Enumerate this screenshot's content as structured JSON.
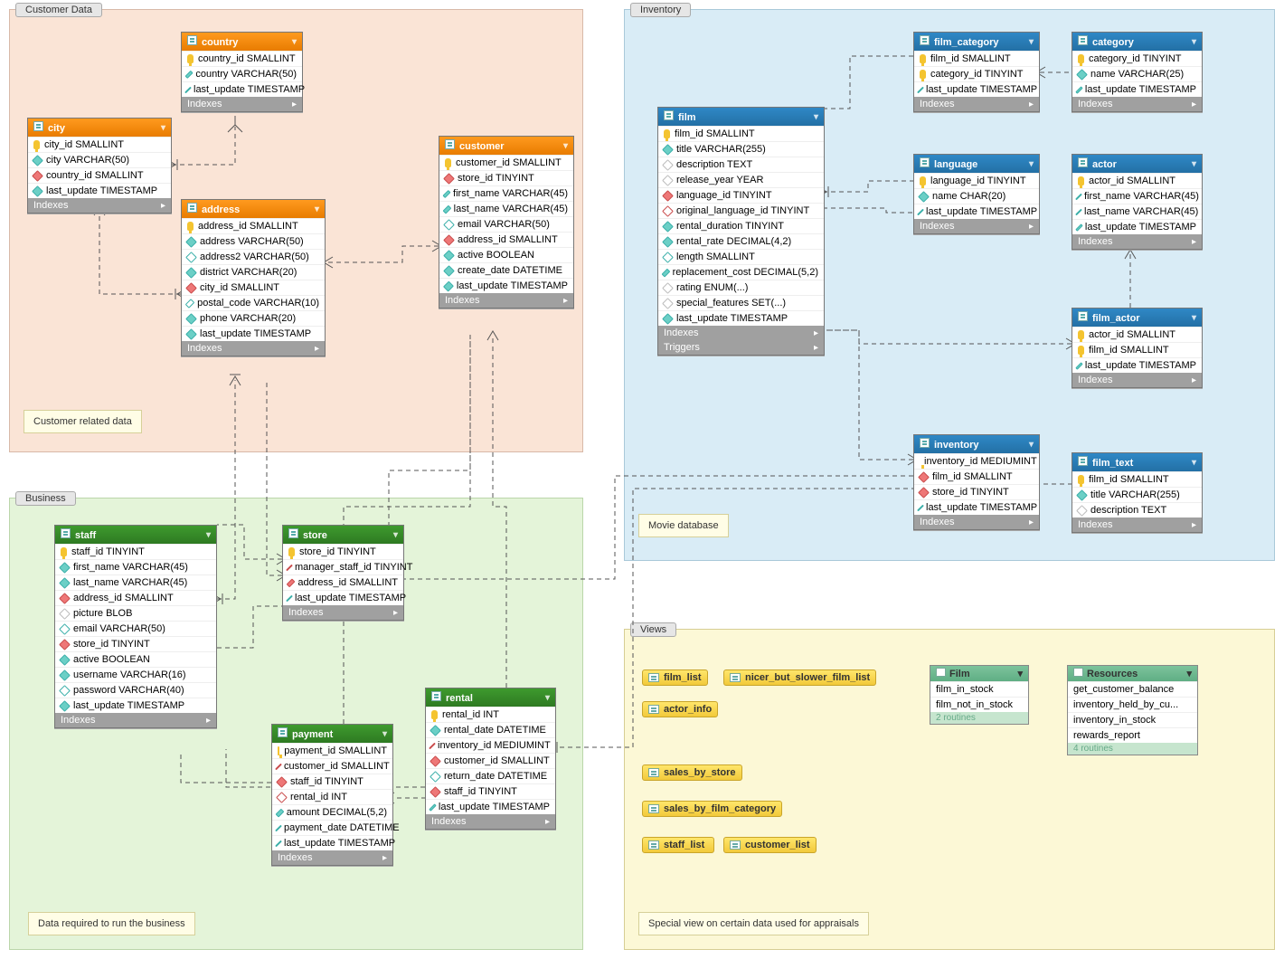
{
  "regions": {
    "customer": {
      "label": "Customer Data",
      "note": "Customer related data"
    },
    "business": {
      "label": "Business",
      "note": "Data required to run the business"
    },
    "inventory": {
      "label": "Inventory",
      "note": "Movie database"
    },
    "views": {
      "label": "Views",
      "note": "Special view on certain data used for appraisals"
    }
  },
  "section_labels": {
    "indexes": "Indexes",
    "triggers": "Triggers"
  },
  "entities": {
    "country": {
      "title": "country",
      "cols": [
        {
          "i": "pk",
          "t": "country_id SMALLINT"
        },
        {
          "i": "c-cyan f",
          "t": "country VARCHAR(50)"
        },
        {
          "i": "c-cyan f",
          "t": "last_update TIMESTAMP"
        }
      ],
      "sects": [
        "indexes"
      ]
    },
    "city": {
      "title": "city",
      "cols": [
        {
          "i": "pk",
          "t": "city_id SMALLINT"
        },
        {
          "i": "c-cyan f",
          "t": "city VARCHAR(50)"
        },
        {
          "i": "c-red f",
          "t": "country_id SMALLINT"
        },
        {
          "i": "c-cyan f",
          "t": "last_update TIMESTAMP"
        }
      ],
      "sects": [
        "indexes"
      ]
    },
    "address": {
      "title": "address",
      "cols": [
        {
          "i": "pk",
          "t": "address_id SMALLINT"
        },
        {
          "i": "c-cyan f",
          "t": "address VARCHAR(50)"
        },
        {
          "i": "c-cyan",
          "t": "address2 VARCHAR(50)"
        },
        {
          "i": "c-cyan f",
          "t": "district VARCHAR(20)"
        },
        {
          "i": "c-red f",
          "t": "city_id SMALLINT"
        },
        {
          "i": "c-cyan",
          "t": "postal_code VARCHAR(10)"
        },
        {
          "i": "c-cyan f",
          "t": "phone VARCHAR(20)"
        },
        {
          "i": "c-cyan f",
          "t": "last_update TIMESTAMP"
        }
      ],
      "sects": [
        "indexes"
      ]
    },
    "customer": {
      "title": "customer",
      "cols": [
        {
          "i": "pk",
          "t": "customer_id SMALLINT"
        },
        {
          "i": "c-red f",
          "t": "store_id TINYINT"
        },
        {
          "i": "c-cyan f",
          "t": "first_name VARCHAR(45)"
        },
        {
          "i": "c-cyan f",
          "t": "last_name VARCHAR(45)"
        },
        {
          "i": "c-cyan",
          "t": "email VARCHAR(50)"
        },
        {
          "i": "c-red f",
          "t": "address_id SMALLINT"
        },
        {
          "i": "c-cyan f",
          "t": "active BOOLEAN"
        },
        {
          "i": "c-cyan f",
          "t": "create_date DATETIME"
        },
        {
          "i": "c-cyan f",
          "t": "last_update TIMESTAMP"
        }
      ],
      "sects": [
        "indexes"
      ]
    },
    "staff": {
      "title": "staff",
      "cols": [
        {
          "i": "pk",
          "t": "staff_id TINYINT"
        },
        {
          "i": "c-cyan f",
          "t": "first_name VARCHAR(45)"
        },
        {
          "i": "c-cyan f",
          "t": "last_name VARCHAR(45)"
        },
        {
          "i": "c-red f",
          "t": "address_id SMALLINT"
        },
        {
          "i": "c-none",
          "t": "picture BLOB"
        },
        {
          "i": "c-cyan",
          "t": "email VARCHAR(50)"
        },
        {
          "i": "c-red f",
          "t": "store_id TINYINT"
        },
        {
          "i": "c-cyan f",
          "t": "active BOOLEAN"
        },
        {
          "i": "c-cyan f",
          "t": "username VARCHAR(16)"
        },
        {
          "i": "c-cyan",
          "t": "password VARCHAR(40)"
        },
        {
          "i": "c-cyan f",
          "t": "last_update TIMESTAMP"
        }
      ],
      "sects": [
        "indexes"
      ]
    },
    "store": {
      "title": "store",
      "cols": [
        {
          "i": "pk",
          "t": "store_id TINYINT"
        },
        {
          "i": "c-red f",
          "t": "manager_staff_id TINYINT"
        },
        {
          "i": "c-red f",
          "t": "address_id SMALLINT"
        },
        {
          "i": "c-cyan f",
          "t": "last_update TIMESTAMP"
        }
      ],
      "sects": [
        "indexes"
      ]
    },
    "payment": {
      "title": "payment",
      "cols": [
        {
          "i": "pk",
          "t": "payment_id SMALLINT"
        },
        {
          "i": "c-red f",
          "t": "customer_id SMALLINT"
        },
        {
          "i": "c-red f",
          "t": "staff_id TINYINT"
        },
        {
          "i": "c-red",
          "t": "rental_id INT"
        },
        {
          "i": "c-cyan f",
          "t": "amount DECIMAL(5,2)"
        },
        {
          "i": "c-cyan f",
          "t": "payment_date DATETIME"
        },
        {
          "i": "c-cyan f",
          "t": "last_update TIMESTAMP"
        }
      ],
      "sects": [
        "indexes"
      ]
    },
    "rental": {
      "title": "rental",
      "cols": [
        {
          "i": "pk",
          "t": "rental_id INT"
        },
        {
          "i": "c-cyan f",
          "t": "rental_date DATETIME"
        },
        {
          "i": "c-red f",
          "t": "inventory_id MEDIUMINT"
        },
        {
          "i": "c-red f",
          "t": "customer_id SMALLINT"
        },
        {
          "i": "c-cyan",
          "t": "return_date DATETIME"
        },
        {
          "i": "c-red f",
          "t": "staff_id TINYINT"
        },
        {
          "i": "c-cyan f",
          "t": "last_update TIMESTAMP"
        }
      ],
      "sects": [
        "indexes"
      ]
    },
    "film": {
      "title": "film",
      "cols": [
        {
          "i": "pk",
          "t": "film_id SMALLINT"
        },
        {
          "i": "c-cyan f",
          "t": "title VARCHAR(255)"
        },
        {
          "i": "c-none",
          "t": "description TEXT"
        },
        {
          "i": "c-none",
          "t": "release_year YEAR"
        },
        {
          "i": "c-red f",
          "t": "language_id TINYINT"
        },
        {
          "i": "c-red",
          "t": "original_language_id TINYINT"
        },
        {
          "i": "c-cyan f",
          "t": "rental_duration TINYINT"
        },
        {
          "i": "c-cyan f",
          "t": "rental_rate DECIMAL(4,2)"
        },
        {
          "i": "c-cyan",
          "t": "length SMALLINT"
        },
        {
          "i": "c-cyan f",
          "t": "replacement_cost DECIMAL(5,2)"
        },
        {
          "i": "c-none",
          "t": "rating ENUM(...)"
        },
        {
          "i": "c-none",
          "t": "special_features SET(...)"
        },
        {
          "i": "c-cyan f",
          "t": "last_update TIMESTAMP"
        }
      ],
      "sects": [
        "indexes",
        "triggers"
      ]
    },
    "film_category": {
      "title": "film_category",
      "cols": [
        {
          "i": "pk",
          "t": "film_id SMALLINT"
        },
        {
          "i": "pk",
          "t": "category_id TINYINT"
        },
        {
          "i": "c-cyan f",
          "t": "last_update TIMESTAMP"
        }
      ],
      "sects": [
        "indexes"
      ]
    },
    "category": {
      "title": "category",
      "cols": [
        {
          "i": "pk",
          "t": "category_id TINYINT"
        },
        {
          "i": "c-cyan f",
          "t": "name VARCHAR(25)"
        },
        {
          "i": "c-cyan f",
          "t": "last_update TIMESTAMP"
        }
      ],
      "sects": [
        "indexes"
      ]
    },
    "language": {
      "title": "language",
      "cols": [
        {
          "i": "pk",
          "t": "language_id TINYINT"
        },
        {
          "i": "c-cyan f",
          "t": "name CHAR(20)"
        },
        {
          "i": "c-cyan f",
          "t": "last_update TIMESTAMP"
        }
      ],
      "sects": [
        "indexes"
      ]
    },
    "actor": {
      "title": "actor",
      "cols": [
        {
          "i": "pk",
          "t": "actor_id SMALLINT"
        },
        {
          "i": "c-cyan f",
          "t": "first_name VARCHAR(45)"
        },
        {
          "i": "c-cyan f",
          "t": "last_name VARCHAR(45)"
        },
        {
          "i": "c-cyan f",
          "t": "last_update TIMESTAMP"
        }
      ],
      "sects": [
        "indexes"
      ]
    },
    "film_actor": {
      "title": "film_actor",
      "cols": [
        {
          "i": "pk",
          "t": "actor_id SMALLINT"
        },
        {
          "i": "pk",
          "t": "film_id SMALLINT"
        },
        {
          "i": "c-cyan f",
          "t": "last_update TIMESTAMP"
        }
      ],
      "sects": [
        "indexes"
      ]
    },
    "inventory": {
      "title": "inventory",
      "cols": [
        {
          "i": "pk",
          "t": "inventory_id MEDIUMINT"
        },
        {
          "i": "c-red f",
          "t": "film_id SMALLINT"
        },
        {
          "i": "c-red f",
          "t": "store_id TINYINT"
        },
        {
          "i": "c-cyan f",
          "t": "last_update TIMESTAMP"
        }
      ],
      "sects": [
        "indexes"
      ]
    },
    "film_text": {
      "title": "film_text",
      "cols": [
        {
          "i": "pk",
          "t": "film_id SMALLINT"
        },
        {
          "i": "c-cyan f",
          "t": "title VARCHAR(255)"
        },
        {
          "i": "c-none",
          "t": "description TEXT"
        }
      ],
      "sects": [
        "indexes"
      ]
    }
  },
  "views": {
    "chips": [
      "film_list",
      "nicer_but_slower_film_list",
      "actor_info",
      "sales_by_store",
      "sales_by_film_category",
      "staff_list",
      "customer_list"
    ]
  },
  "routine_groups": {
    "film": {
      "title": "Film",
      "rows": [
        "film_in_stock",
        "film_not_in_stock"
      ],
      "footer": "2 routines"
    },
    "resources": {
      "title": "Resources",
      "rows": [
        "get_customer_balance",
        "inventory_held_by_cu...",
        "inventory_in_stock",
        "rewards_report"
      ],
      "footer": "4 routines"
    }
  }
}
